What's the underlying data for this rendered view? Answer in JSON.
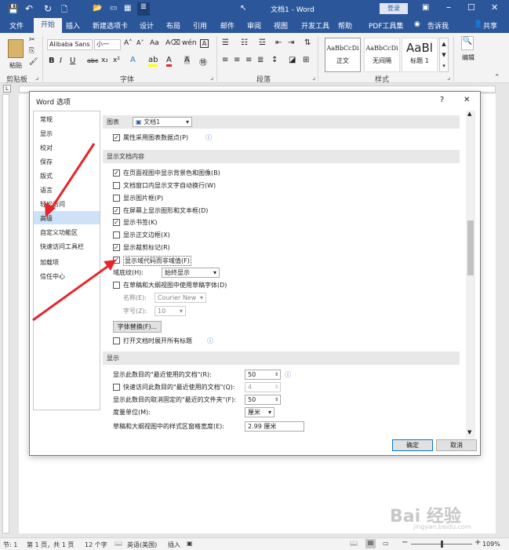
{
  "window": {
    "title": "文档1 - Word",
    "login_label": "登录"
  },
  "tabs": [
    "文件",
    "开始",
    "插入",
    "新建选项卡",
    "设计",
    "布局",
    "引用",
    "邮件",
    "审阅",
    "视图",
    "开发工具",
    "帮助",
    "PDF工具集"
  ],
  "tell_me": "告诉我",
  "share": "共享",
  "ribbon": {
    "paste_label": "粘贴",
    "font_name": "Alibaba Sans",
    "font_size": "小一",
    "format_buttons": [
      "B",
      "I",
      "U",
      "abc",
      "x₂",
      "x²"
    ],
    "styles": [
      {
        "preview": "AaBbCcDi",
        "name": "正文"
      },
      {
        "preview": "AaBbCcDi",
        "name": "无间隔"
      },
      {
        "preview": "AaBl",
        "name": "标题 1"
      }
    ],
    "edit_label": "编辑",
    "groups": [
      "剪贴板",
      "字体",
      "段落",
      "样式"
    ]
  },
  "dialog": {
    "title": "Word 选项",
    "help": "?",
    "close": "✕",
    "nav": [
      "常规",
      "显示",
      "校对",
      "保存",
      "版式",
      "语言",
      "轻松访问",
      "高级",
      "自定义功能区",
      "快速访问工具栏",
      "加载项",
      "信任中心"
    ],
    "selected_nav": "高级",
    "chart_label": "图表",
    "chart_doc": "文档1",
    "chart_opt": "属性采用图表数据点(P)",
    "section_doc": "显示文档内容",
    "doc_options": [
      {
        "label": "在页面视图中显示背景色和图像(B)",
        "checked": true
      },
      {
        "label": "文档窗口内显示文字自动换行(W)",
        "checked": false
      },
      {
        "label": "显示图片框(P)",
        "checked": false
      },
      {
        "label": "在屏幕上显示图形和文本框(D)",
        "checked": true
      },
      {
        "label": "显示书签(K)",
        "checked": true
      },
      {
        "label": "显示正文边框(X)",
        "checked": false
      },
      {
        "label": "显示裁剪标记(R)",
        "checked": true
      },
      {
        "label": "显示域代码而非域值(F)",
        "checked": true
      }
    ],
    "field_shading_label": "域底纹(H):",
    "field_shading_value": "始终显示",
    "draft_font_opt": "在草稿和大纲视图中使用草稿字体(D)",
    "name_label": "名称(E):",
    "name_value": "Courier New",
    "size_label": "字号(Z):",
    "size_value": "10",
    "font_sub_button": "字体替换(F)...",
    "expand_headings": "打开文档时展开所有标题",
    "section_display": "显示",
    "recent_docs_label": "显示此数目的\"最近使用的文档\"(R):",
    "recent_docs_value": "50",
    "quick_access_label": "快速访问此数目的\"最近使用的文档\"(Q):",
    "quick_access_value": "4",
    "pinned_label": "显示此数目的取消固定的\"最近的文件夹\"(F):",
    "pinned_value": "50",
    "units_label": "度量单位(M):",
    "units_value": "厘米",
    "style_width_label": "草稿和大纲视图中的样式区窗格宽度(E):",
    "style_width_value": "2.99 厘米",
    "ok": "确定",
    "cancel": "取消"
  },
  "status": {
    "page": "节: 1",
    "pages": "第 1 页，共 1 页",
    "words": "12 个字",
    "lang": "英语(美国)",
    "mode": "插入",
    "zoom": "109%"
  },
  "colors": {
    "brand": "#2b579a",
    "arrow": "#e5262c",
    "selected": "#cde1f7"
  }
}
